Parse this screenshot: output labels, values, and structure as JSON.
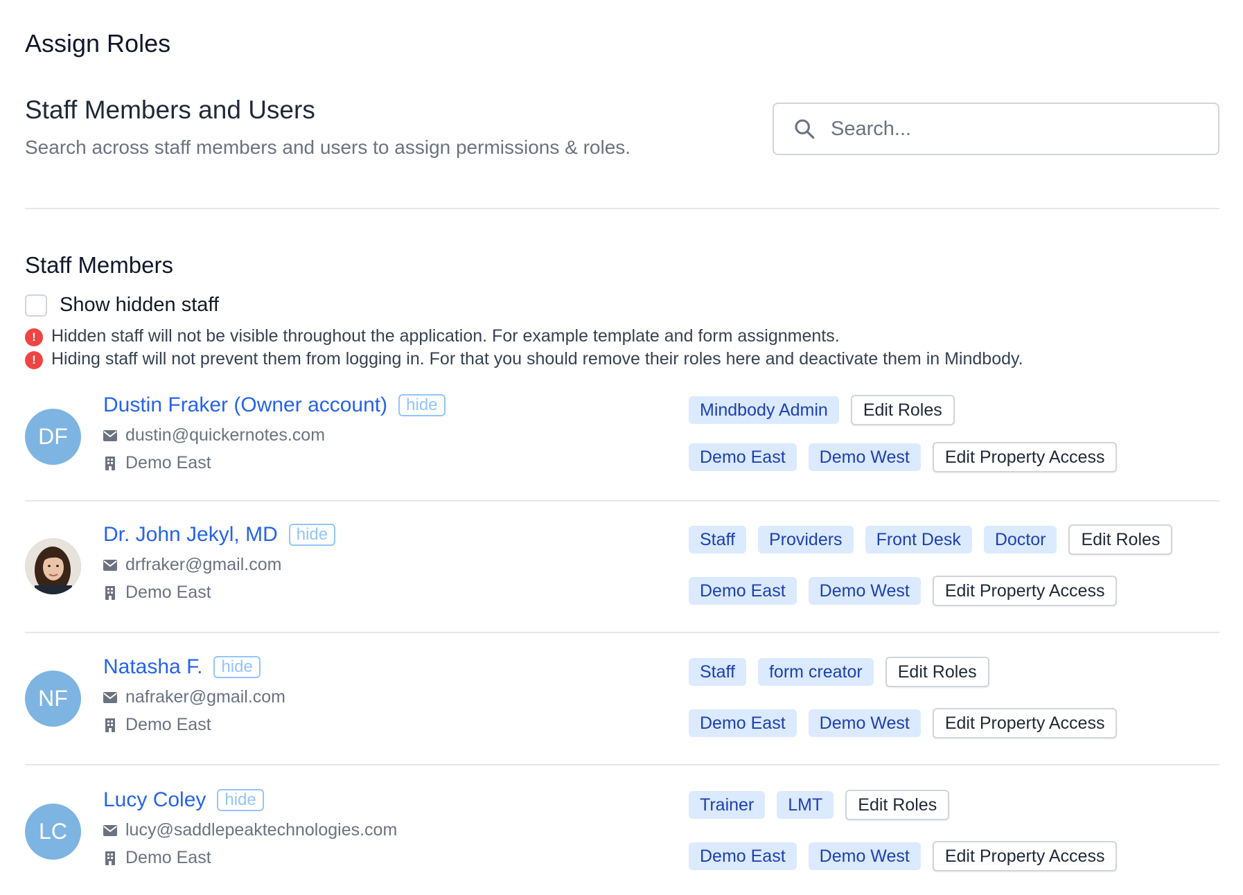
{
  "page": {
    "title": "Assign Roles"
  },
  "section": {
    "title": "Staff Members and Users",
    "subtitle": "Search across staff members and users to assign permissions & roles."
  },
  "search": {
    "placeholder": "Search...",
    "icon": "search-icon"
  },
  "staff_section": {
    "heading": "Staff Members",
    "show_hidden_label": "Show hidden staff",
    "show_hidden_checked": false,
    "notes": [
      "Hidden staff will not be visible throughout the application. For example template and form assignments.",
      "Hiding staff will not prevent them from logging in. For that you should remove their roles here and deactivate them in Mindbody."
    ]
  },
  "labels": {
    "hide": "hide",
    "edit_roles": "Edit Roles",
    "edit_property_access": "Edit Property Access"
  },
  "colors": {
    "link": "#2563eb",
    "tag_bg": "#dbeafe",
    "tag_text": "#1e40af",
    "avatar_bg": "#7eb4e2",
    "warning": "#ef4444"
  },
  "staff": [
    {
      "initials": "DF",
      "has_photo": false,
      "name": "Dustin Fraker (Owner account)",
      "email": "dustin@quickernotes.com",
      "location": "Demo East",
      "roles": [
        "Mindbody Admin"
      ],
      "properties": [
        "Demo East",
        "Demo West"
      ]
    },
    {
      "initials": "",
      "has_photo": true,
      "name": "Dr. John Jekyl, MD",
      "email": "drfraker@gmail.com",
      "location": "Demo East",
      "roles": [
        "Staff",
        "Providers",
        "Front Desk",
        "Doctor"
      ],
      "properties": [
        "Demo East",
        "Demo West"
      ]
    },
    {
      "initials": "NF",
      "has_photo": false,
      "name": "Natasha F.",
      "email": "nafraker@gmail.com",
      "location": "Demo East",
      "roles": [
        "Staff",
        "form creator"
      ],
      "properties": [
        "Demo East",
        "Demo West"
      ]
    },
    {
      "initials": "LC",
      "has_photo": false,
      "name": "Lucy Coley",
      "email": "lucy@saddlepeaktechnologies.com",
      "location": "Demo East",
      "roles": [
        "Trainer",
        "LMT"
      ],
      "properties": [
        "Demo East",
        "Demo West"
      ]
    }
  ]
}
